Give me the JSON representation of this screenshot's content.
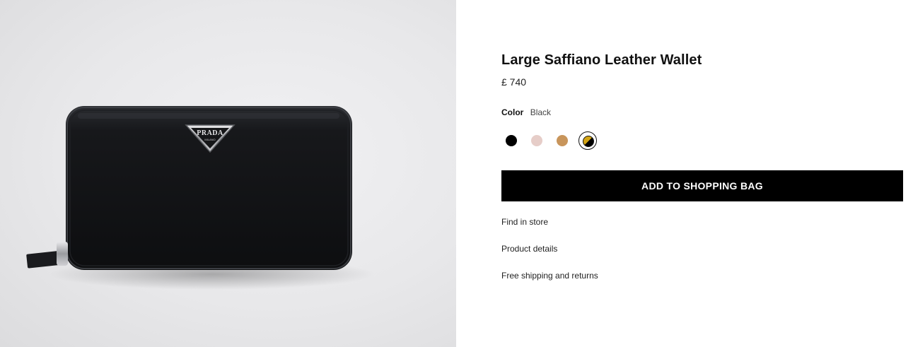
{
  "product": {
    "title": "Large Saffiano Leather Wallet",
    "price": "£ 740",
    "image_alt": "Black Saffiano leather zip-around wallet with triangle logo",
    "logo_text": "PRADA",
    "logo_subtext": "MILANO"
  },
  "color": {
    "label": "Color",
    "selected": "Black",
    "swatches": [
      {
        "name": "black",
        "hex": "#000000"
      },
      {
        "name": "powder-pink",
        "hex": "#e6cdc8"
      },
      {
        "name": "caramel",
        "hex": "#c8955b"
      },
      {
        "name": "black-yellow",
        "hex": "#d4a514"
      }
    ]
  },
  "actions": {
    "add_to_bag": "ADD TO SHOPPING BAG"
  },
  "links": {
    "find_in_store": "Find in store",
    "product_details": "Product details",
    "shipping": "Free shipping and returns"
  }
}
